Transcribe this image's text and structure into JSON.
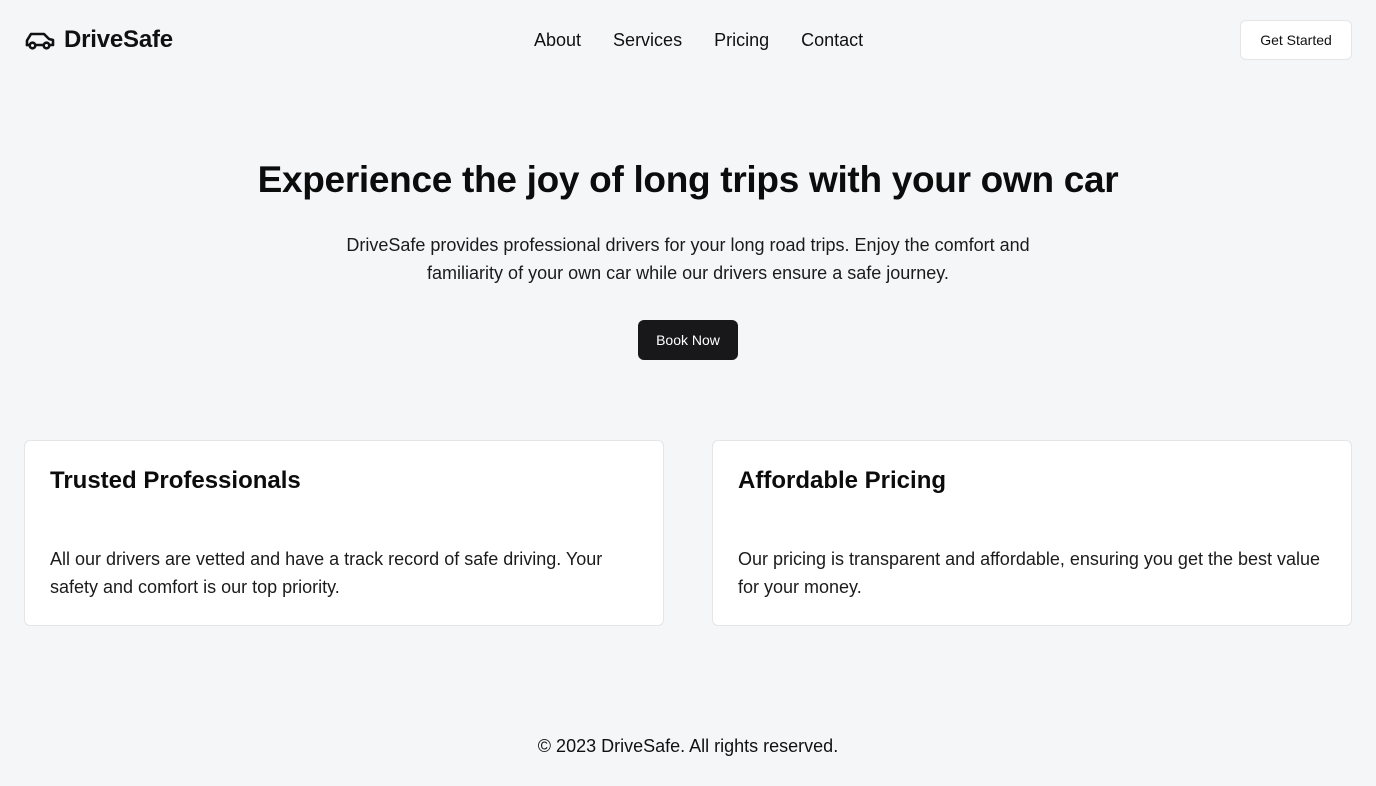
{
  "header": {
    "brand": {
      "name": "DriveSafe",
      "icon": "car-icon"
    },
    "nav": [
      {
        "label": "About"
      },
      {
        "label": "Services"
      },
      {
        "label": "Pricing"
      },
      {
        "label": "Contact"
      }
    ],
    "cta_label": "Get Started"
  },
  "hero": {
    "title": "Experience the joy of long trips with your own car",
    "description": "DriveSafe provides professional drivers for your long road trips. Enjoy the comfort and familiarity of your own car while our drivers ensure a safe journey.",
    "button_label": "Book Now"
  },
  "features": [
    {
      "title": "Trusted Professionals",
      "text": "All our drivers are vetted and have a track record of safe driving. Your safety and comfort is our top priority."
    },
    {
      "title": "Affordable Pricing",
      "text": "Our pricing is transparent and affordable, ensuring you get the best value for your money."
    }
  ],
  "footer": {
    "copyright": "© 2023 DriveSafe. All rights reserved."
  },
  "colors": {
    "background": "#f5f6f8",
    "primary_button": "#18181b",
    "card": "#ffffff",
    "border": "#e3e5e8",
    "text": "#111111"
  }
}
